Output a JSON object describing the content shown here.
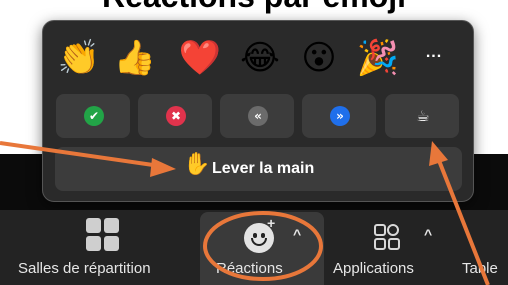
{
  "heading_crop": "Réactions par emoji",
  "panel": {
    "emojis": [
      {
        "glyph": "👏",
        "name": "clapping-hands"
      },
      {
        "glyph": "👍",
        "name": "thumbs-up"
      },
      {
        "glyph": "❤️",
        "name": "red-heart"
      },
      {
        "glyph": "😂",
        "name": "tears-of-joy"
      },
      {
        "glyph": "😮",
        "name": "open-mouth"
      },
      {
        "glyph": "🎉",
        "name": "party-popper"
      }
    ],
    "more_label": "...",
    "feedback_buttons": [
      {
        "name": "yes",
        "glyph": "✔",
        "color": "#22a447"
      },
      {
        "name": "no",
        "glyph": "✖",
        "color": "#e0334c"
      },
      {
        "name": "slower",
        "glyph": "«",
        "color": "#6b6b6b"
      },
      {
        "name": "faster",
        "glyph": "»",
        "color": "#1f6feb"
      },
      {
        "name": "coffee",
        "glyph": "☕",
        "color": "#3c3c3c"
      }
    ],
    "raise_hand_label": "Lever la main",
    "raise_hand_glyph": "✋"
  },
  "toolbar": {
    "breakout_label": "Salles de répartition",
    "reactions_label": "Réactions",
    "apps_label": "Applications",
    "more_label": "Table",
    "caret": "^"
  },
  "colors": {
    "annotation": "#e8773a"
  }
}
